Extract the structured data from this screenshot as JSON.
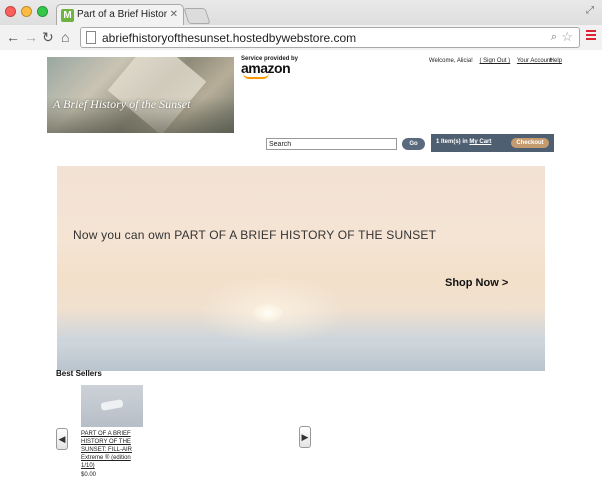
{
  "browser": {
    "tab_title": "Part of a Brief History of th",
    "tab_favicon": "M",
    "url": "abriefhistoryofthesunset.hostedbywebstore.com"
  },
  "header": {
    "logo_text": "A Brief History of the Sunset",
    "amazon_caption": "Service provided by",
    "amazon_word": "amazon",
    "welcome": "Welcome, Alicia!",
    "sign_out": "( Sign Out )",
    "your_account": "Your Account",
    "help": "Help"
  },
  "search": {
    "value": "Search",
    "go_label": "Go"
  },
  "cart": {
    "items_text": "1 Item(s) in",
    "my_cart": "My Cart",
    "checkout_label": "Checkout"
  },
  "hero": {
    "headline": "Now you can own PART OF A BRIEF HISTORY OF THE SUNSET",
    "cta": "Shop Now >"
  },
  "best_sellers": {
    "title": "Best Sellers",
    "items": [
      {
        "name": "PART OF A BRIEF HISTORY OF THE SUNSET: FILL-AIR Extreme ® (edition 1/10)",
        "price": "$0.00"
      }
    ]
  }
}
